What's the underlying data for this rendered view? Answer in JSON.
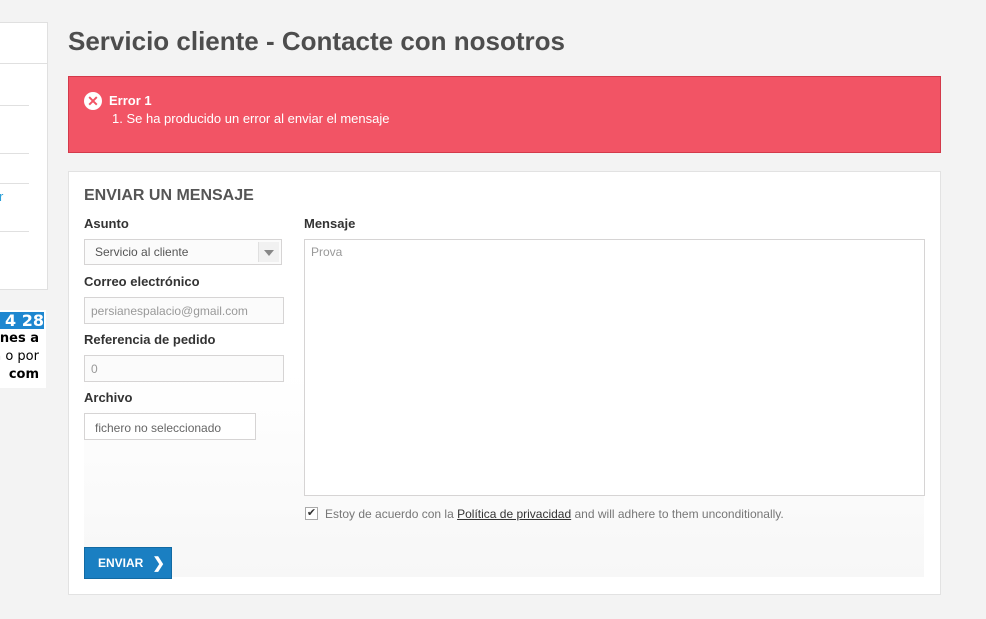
{
  "sidebar": {
    "link_fragment": "r",
    "phone_fragment": "4 28",
    "text_lines": [
      "nes a",
      "a o por",
      "com"
    ]
  },
  "page": {
    "title": "Servicio cliente - Contacte con nosotros"
  },
  "alert": {
    "icon": "close-circle-icon",
    "title": "Error 1",
    "message": "1. Se ha producido un error al enviar el mensaje"
  },
  "form": {
    "heading": "ENVIAR UN MENSAJE",
    "subject": {
      "label": "Asunto",
      "value": "Servicio al cliente"
    },
    "email": {
      "label": "Correo electrónico",
      "value": "persianespalacio@gmail.com"
    },
    "order_ref": {
      "label": "Referencia de pedido",
      "value": "0"
    },
    "file": {
      "label": "Archivo",
      "value": "fichero no seleccionado"
    },
    "message": {
      "label": "Mensaje",
      "value": "Prova"
    },
    "consent": {
      "prefix": "Estoy de acuerdo con la ",
      "link": "Política de privacidad",
      "suffix": " and will adhere to them unconditionally.",
      "checked": true
    },
    "submit_label": "ENVIAR",
    "submit_icon": "chevron-right-icon"
  },
  "colors": {
    "alert_bg": "#f25465",
    "button_bg": "#1a7fc2"
  }
}
